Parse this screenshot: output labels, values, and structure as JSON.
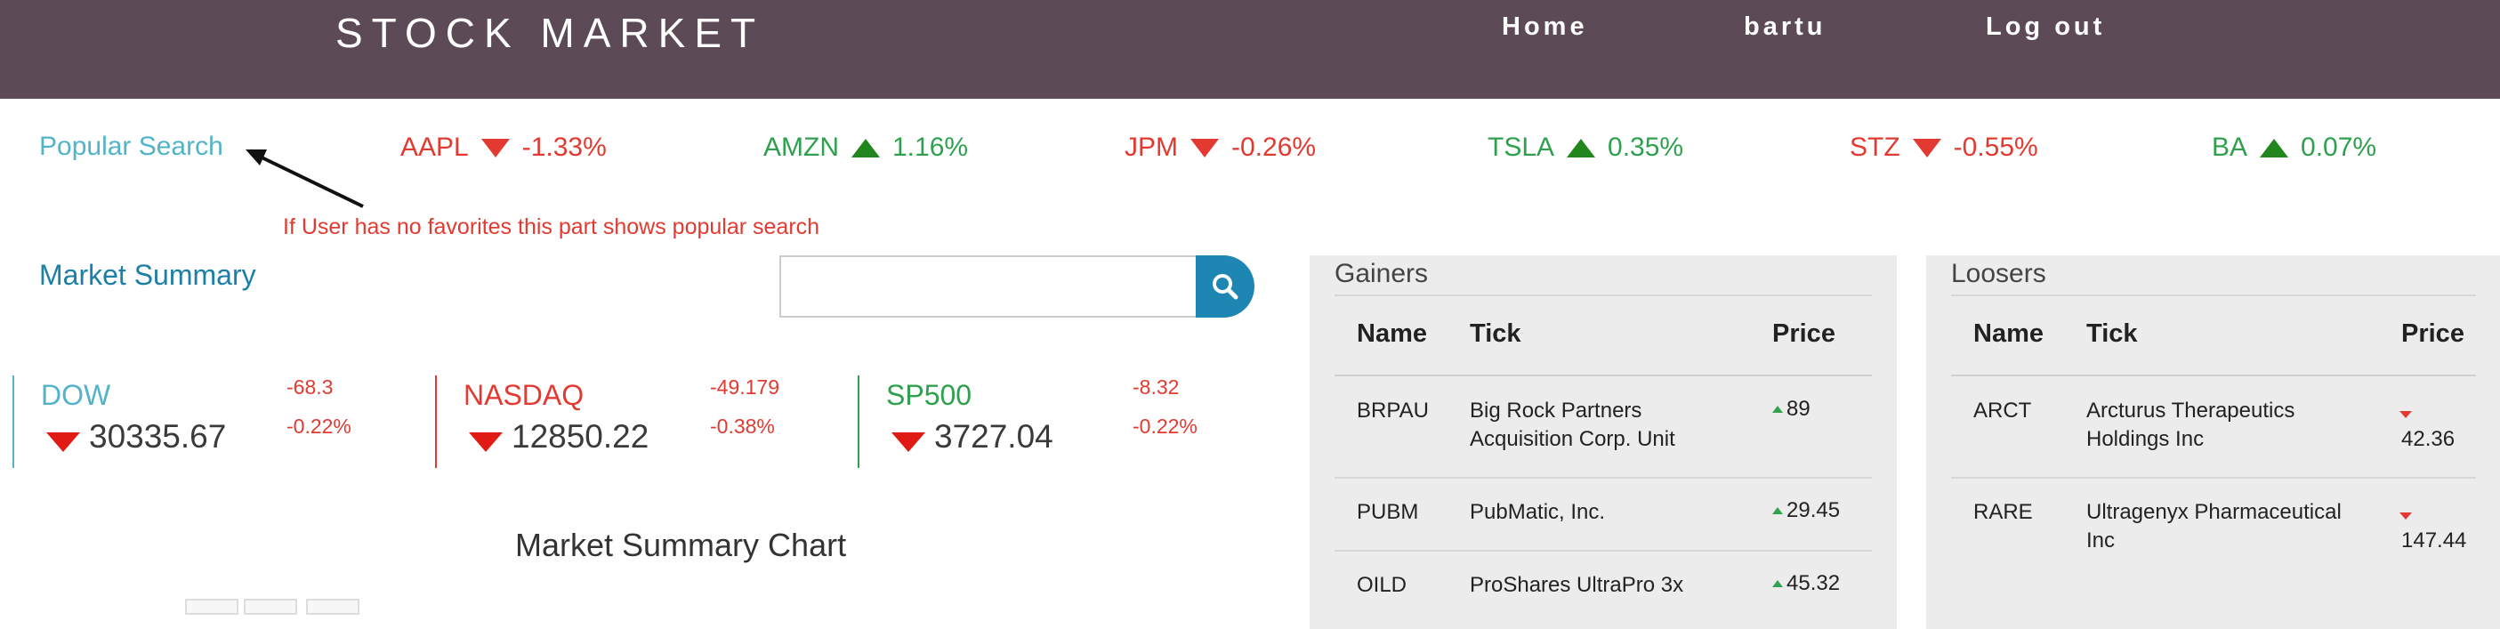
{
  "header": {
    "brand": "STOCK MARKET",
    "nav": [
      "Home",
      "bartu",
      "Log out"
    ]
  },
  "popular": {
    "label": "Popular Search",
    "annotation": "If User has no favorites this part shows popular search",
    "tickers": [
      {
        "symbol": "AAPL",
        "change": "-1.33%",
        "direction": "down"
      },
      {
        "symbol": "AMZN",
        "change": "1.16%",
        "direction": "up"
      },
      {
        "symbol": "JPM",
        "change": "-0.26%",
        "direction": "down"
      },
      {
        "symbol": "TSLA",
        "change": "0.35%",
        "direction": "up"
      },
      {
        "symbol": "STZ",
        "change": "-0.55%",
        "direction": "down"
      },
      {
        "symbol": "BA",
        "change": "0.07%",
        "direction": "up"
      }
    ]
  },
  "market_summary": {
    "title": "Market Summary",
    "search": {
      "value": "",
      "placeholder": ""
    },
    "indices": [
      {
        "name": "DOW",
        "change": "-68.3",
        "pct": "-0.22%",
        "value": "30335.67",
        "color": "#53b4c9"
      },
      {
        "name": "NASDAQ",
        "change": "-49.179",
        "pct": "-0.38%",
        "value": "12850.22",
        "color": "#e23a31"
      },
      {
        "name": "SP500",
        "change": "-8.32",
        "pct": "-0.22%",
        "value": "3727.04",
        "color": "#2fa14e"
      }
    ],
    "chart_title": "Market Summary Chart"
  },
  "gainers": {
    "title": "Gainers",
    "columns": [
      "Name",
      "Tick",
      "Price"
    ],
    "rows": [
      {
        "name": "BRPAU",
        "tick": "Big Rock Partners Acquisition Corp. Unit",
        "price": "89"
      },
      {
        "name": "PUBM",
        "tick": "PubMatic, Inc.",
        "price": "29.45"
      },
      {
        "name": "OILD",
        "tick": "ProShares UltraPro 3x",
        "price": "45.32"
      }
    ]
  },
  "losers": {
    "title": "Loosers",
    "columns": [
      "Name",
      "Tick",
      "Price"
    ],
    "rows": [
      {
        "name": "ARCT",
        "tick": "Arcturus Therapeutics Holdings Inc",
        "price": "42.36"
      },
      {
        "name": "RARE",
        "tick": "Ultragenyx Pharmaceutical Inc",
        "price": "147.44"
      }
    ]
  },
  "colors": {
    "navbar": "#5c4a57",
    "negative": "#e23a31",
    "positive": "#2fa14e",
    "accent": "#1d86b3"
  },
  "icons": [
    "search-icon",
    "triangle-down-icon",
    "triangle-up-icon",
    "arrow-annotation-icon"
  ]
}
